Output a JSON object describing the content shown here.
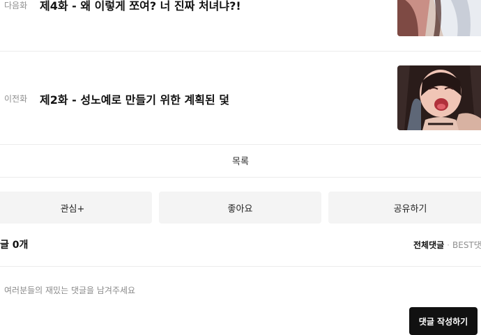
{
  "next_episode": {
    "tag": "다음화",
    "title": "제4화 - 왜 이렇게 쪼여? 너 진짜 처녀냐?!"
  },
  "prev_episode": {
    "tag": "이전화",
    "title": "제2화 - 성노예로 만들기 위한 계획된 덫"
  },
  "list_label": "목록",
  "actions": {
    "interest": "관심+",
    "like": "좋아요",
    "share": "공유하기"
  },
  "comments": {
    "count_label": "글 0개",
    "sort_all": "전체댓글",
    "sort_sep": "·",
    "sort_best": "BEST댓",
    "placeholder": "여러분들의 재밌는 댓글을 남겨주세요",
    "submit_label": "댓글 작성하기"
  }
}
